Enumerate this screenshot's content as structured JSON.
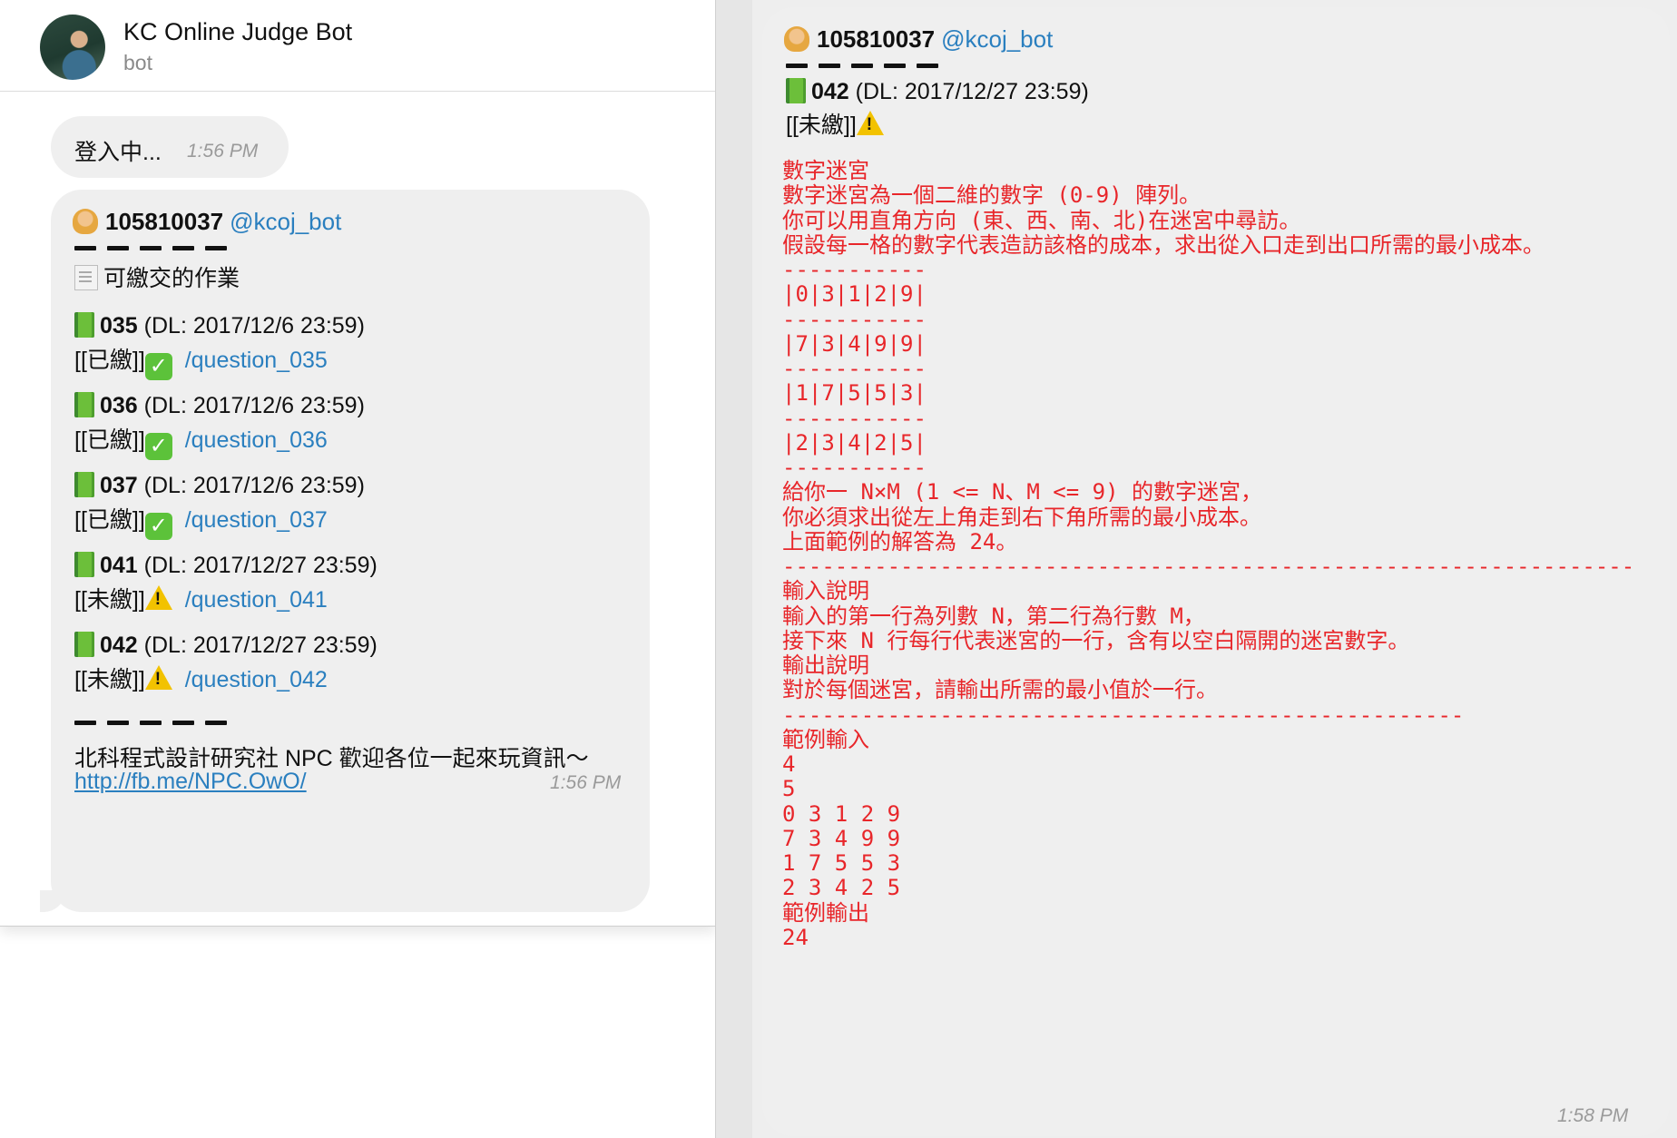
{
  "left": {
    "header": {
      "title": "KC Online Judge Bot",
      "subtitle": "bot"
    },
    "loading": {
      "text": "登入中...",
      "time": "1:56 PM"
    },
    "menu": {
      "sender_id": "105810037",
      "handle": "@kcoj_bot",
      "heading": "可繳交的作業",
      "items": [
        {
          "id": "035",
          "dl": "(DL: 2017/12/6 23:59)",
          "status": "[[已繳]]",
          "status_icon": "check-icon",
          "cmd": "/question_035"
        },
        {
          "id": "036",
          "dl": "(DL: 2017/12/6 23:59)",
          "status": "[[已繳]]",
          "status_icon": "check-icon",
          "cmd": "/question_036"
        },
        {
          "id": "037",
          "dl": "(DL: 2017/12/6 23:59)",
          "status": "[[已繳]]",
          "status_icon": "check-icon",
          "cmd": "/question_037"
        },
        {
          "id": "041",
          "dl": "(DL: 2017/12/27 23:59)",
          "status": "[[未繳]]",
          "status_icon": "warning-icon",
          "cmd": "/question_041"
        },
        {
          "id": "042",
          "dl": "(DL: 2017/12/27 23:59)",
          "status": "[[未繳]]",
          "status_icon": "warning-icon",
          "cmd": "/question_042"
        }
      ],
      "footer": "北科程式設計研究社 NPC 歡迎各位一起來玩資訊～",
      "link": "http://fb.me/NPC.OwO/",
      "time": "1:56 PM"
    }
  },
  "right": {
    "sender_id": "105810037",
    "handle": "@kcoj_bot",
    "question_id": "042",
    "question_dl": "(DL: 2017/12/27 23:59)",
    "question_status": "[[未繳]]",
    "time": "1:58 PM",
    "body_lines": [
      "數字迷宮",
      "數字迷宮為一個二維的數字 (0-9) 陣列。",
      "你可以用直角方向 (東、西、南、北)在迷宮中尋訪。",
      "假設每一格的數字代表造訪該格的成本，求出從入口走到出口所需的最小成本。",
      "-----------",
      "|0|3|1|2|9|",
      "-----------",
      "|7|3|4|9|9|",
      "-----------",
      "|1|7|5|5|3|",
      "-----------",
      "|2|3|4|2|5|",
      "-----------",
      "給你一 N×M (1 <= N、M <= 9) 的數字迷宮，",
      "你必須求出從左上角走到右下角所需的最小成本。",
      "上面範例的解答為 24。",
      "-----------------------------------------------------------------",
      "輸入說明",
      "輸入的第一行為列數 N，第二行為行數 M，",
      "接下來 N 行每行代表迷宮的一行，含有以空白隔開的迷宮數字。",
      "輸出說明",
      "對於每個迷宮，請輸出所需的最小值於一行。",
      "----------------------------------------------------",
      "範例輸入",
      "4",
      "5",
      "0 3 1 2 9",
      "7 3 4 9 9",
      "1 7 5 5 3",
      "2 3 4 2 5",
      "範例輸出",
      "24"
    ]
  }
}
